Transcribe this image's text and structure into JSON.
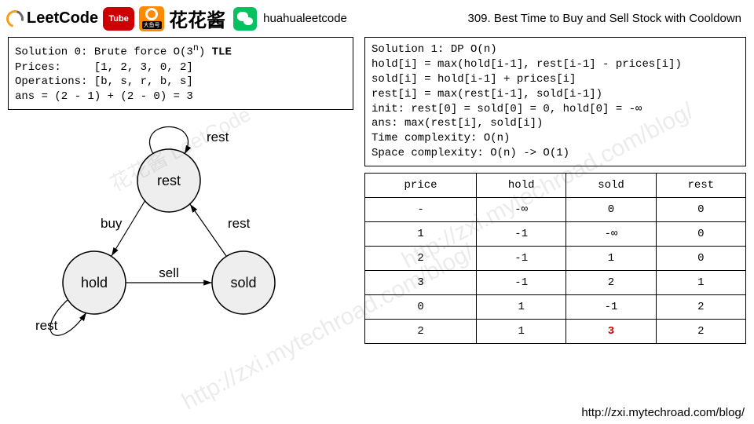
{
  "header": {
    "leetcode": "LeetCode",
    "cn_name": "花花酱",
    "handle": "huahualeetcode",
    "yt_label": "Tube",
    "dayu_label": "大鱼号",
    "problem_title": "309. Best Time to Buy and Sell Stock with Cooldown"
  },
  "solution0": {
    "line1_a": "Solution 0: Brute force O(3",
    "line1_sup": "n",
    "line1_b": ") ",
    "tle": "TLE",
    "line2": "Prices:     [1, 2, 3, 0, 2]",
    "line3": "Operations: [b, s, r, b, s]",
    "line4": "ans = (2 - 1) + (2 - 0) = 3"
  },
  "solution1": {
    "l1": "Solution 1: DP O(n)",
    "l2": "hold[i] = max(hold[i-1], rest[i-1] - prices[i])",
    "l3": "sold[i] = hold[i-1] + prices[i]",
    "l4": "rest[i] = max(rest[i-1], sold[i-1])",
    "l5": "init: rest[0] = sold[0] = 0, hold[0] = -∞",
    "l6": "ans: max(rest[i], sold[i])",
    "l7": "Time complexity: O(n)",
    "l8": "Space complexity: O(n) -> O(1)"
  },
  "diagram": {
    "node_rest": "rest",
    "node_hold": "hold",
    "node_sold": "sold",
    "edge_rest_self": "rest",
    "edge_rest_to_hold": "buy",
    "edge_hold_to_sold": "sell",
    "edge_sold_to_rest": "rest",
    "edge_hold_self": "rest"
  },
  "table": {
    "headers": [
      "price",
      "hold",
      "sold",
      "rest"
    ],
    "rows": [
      [
        "-",
        "-∞",
        "0",
        "0"
      ],
      [
        "1",
        "-1",
        "-∞",
        "0"
      ],
      [
        "2",
        "-1",
        "1",
        "0"
      ],
      [
        "3",
        "-1",
        "2",
        "1"
      ],
      [
        "0",
        "1",
        "-1",
        "2"
      ],
      [
        "2",
        "1",
        "3",
        "2"
      ]
    ],
    "highlight": {
      "row": 5,
      "col": 2
    }
  },
  "watermark": "http://zxi.mytechroad.com/blog/",
  "footer_url": "http://zxi.mytechroad.com/blog/",
  "chart_data": {
    "type": "table",
    "title": "DP state table for LeetCode 309",
    "columns": [
      "price",
      "hold",
      "sold",
      "rest"
    ],
    "rows": [
      {
        "price": "-",
        "hold": "-∞",
        "sold": 0,
        "rest": 0
      },
      {
        "price": 1,
        "hold": -1,
        "sold": "-∞",
        "rest": 0
      },
      {
        "price": 2,
        "hold": -1,
        "sold": 1,
        "rest": 0
      },
      {
        "price": 3,
        "hold": -1,
        "sold": 2,
        "rest": 1
      },
      {
        "price": 0,
        "hold": 1,
        "sold": -1,
        "rest": 2
      },
      {
        "price": 2,
        "hold": 1,
        "sold": 3,
        "rest": 2
      }
    ],
    "answer": 3,
    "state_machine": {
      "nodes": [
        "rest",
        "hold",
        "sold"
      ],
      "edges": [
        {
          "from": "rest",
          "to": "rest",
          "label": "rest"
        },
        {
          "from": "rest",
          "to": "hold",
          "label": "buy"
        },
        {
          "from": "hold",
          "to": "hold",
          "label": "rest"
        },
        {
          "from": "hold",
          "to": "sold",
          "label": "sell"
        },
        {
          "from": "sold",
          "to": "rest",
          "label": "rest"
        }
      ]
    }
  }
}
